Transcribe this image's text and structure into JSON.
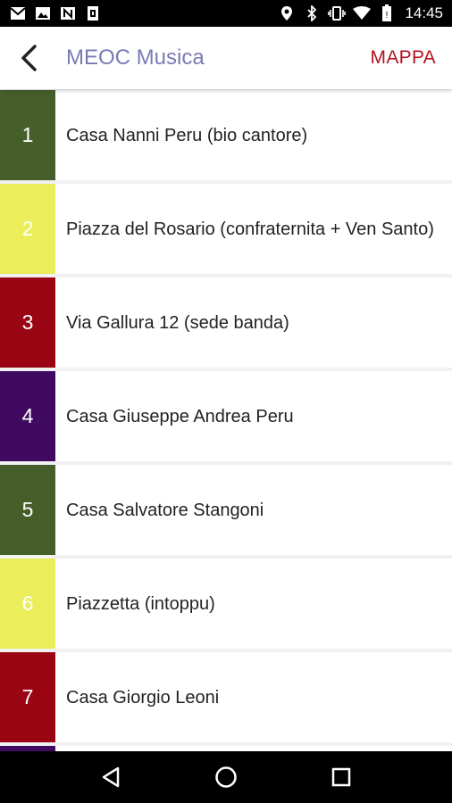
{
  "status_bar": {
    "time": "14:45",
    "left_icons": [
      "mail-icon",
      "image-icon",
      "n-icon",
      "sim-icon"
    ],
    "right_icons": [
      "location-icon",
      "bluetooth-icon",
      "vibrate-icon",
      "wifi-icon",
      "battery-icon"
    ]
  },
  "app_bar": {
    "title": "MEOC Musica",
    "map_label": "MAPPA",
    "title_color": "#7a7ab5",
    "map_color": "#b3121d"
  },
  "items": [
    {
      "number": "1",
      "label": "Casa Nanni Peru (bio cantore)",
      "color": "#465f2a"
    },
    {
      "number": "2",
      "label": "Piazza del Rosario (confraternita + Ven Santo)",
      "color": "#ebed5a"
    },
    {
      "number": "3",
      "label": "Via Gallura 12 (sede banda)",
      "color": "#9a0513"
    },
    {
      "number": "4",
      "label": "Casa Giuseppe Andrea Peru",
      "color": "#3f0a60"
    },
    {
      "number": "5",
      "label": "Casa Salvatore Stangoni",
      "color": "#465f2a"
    },
    {
      "number": "6",
      "label": "Piazzetta (intoppu)",
      "color": "#ebed5a"
    },
    {
      "number": "7",
      "label": "Casa Giorgio Leoni",
      "color": "#9a0513"
    },
    {
      "number": "",
      "label": "",
      "color": "#3f0a60"
    }
  ],
  "nav_bar": {
    "buttons": [
      "back-triangle-icon",
      "home-circle-icon",
      "recents-square-icon"
    ]
  }
}
